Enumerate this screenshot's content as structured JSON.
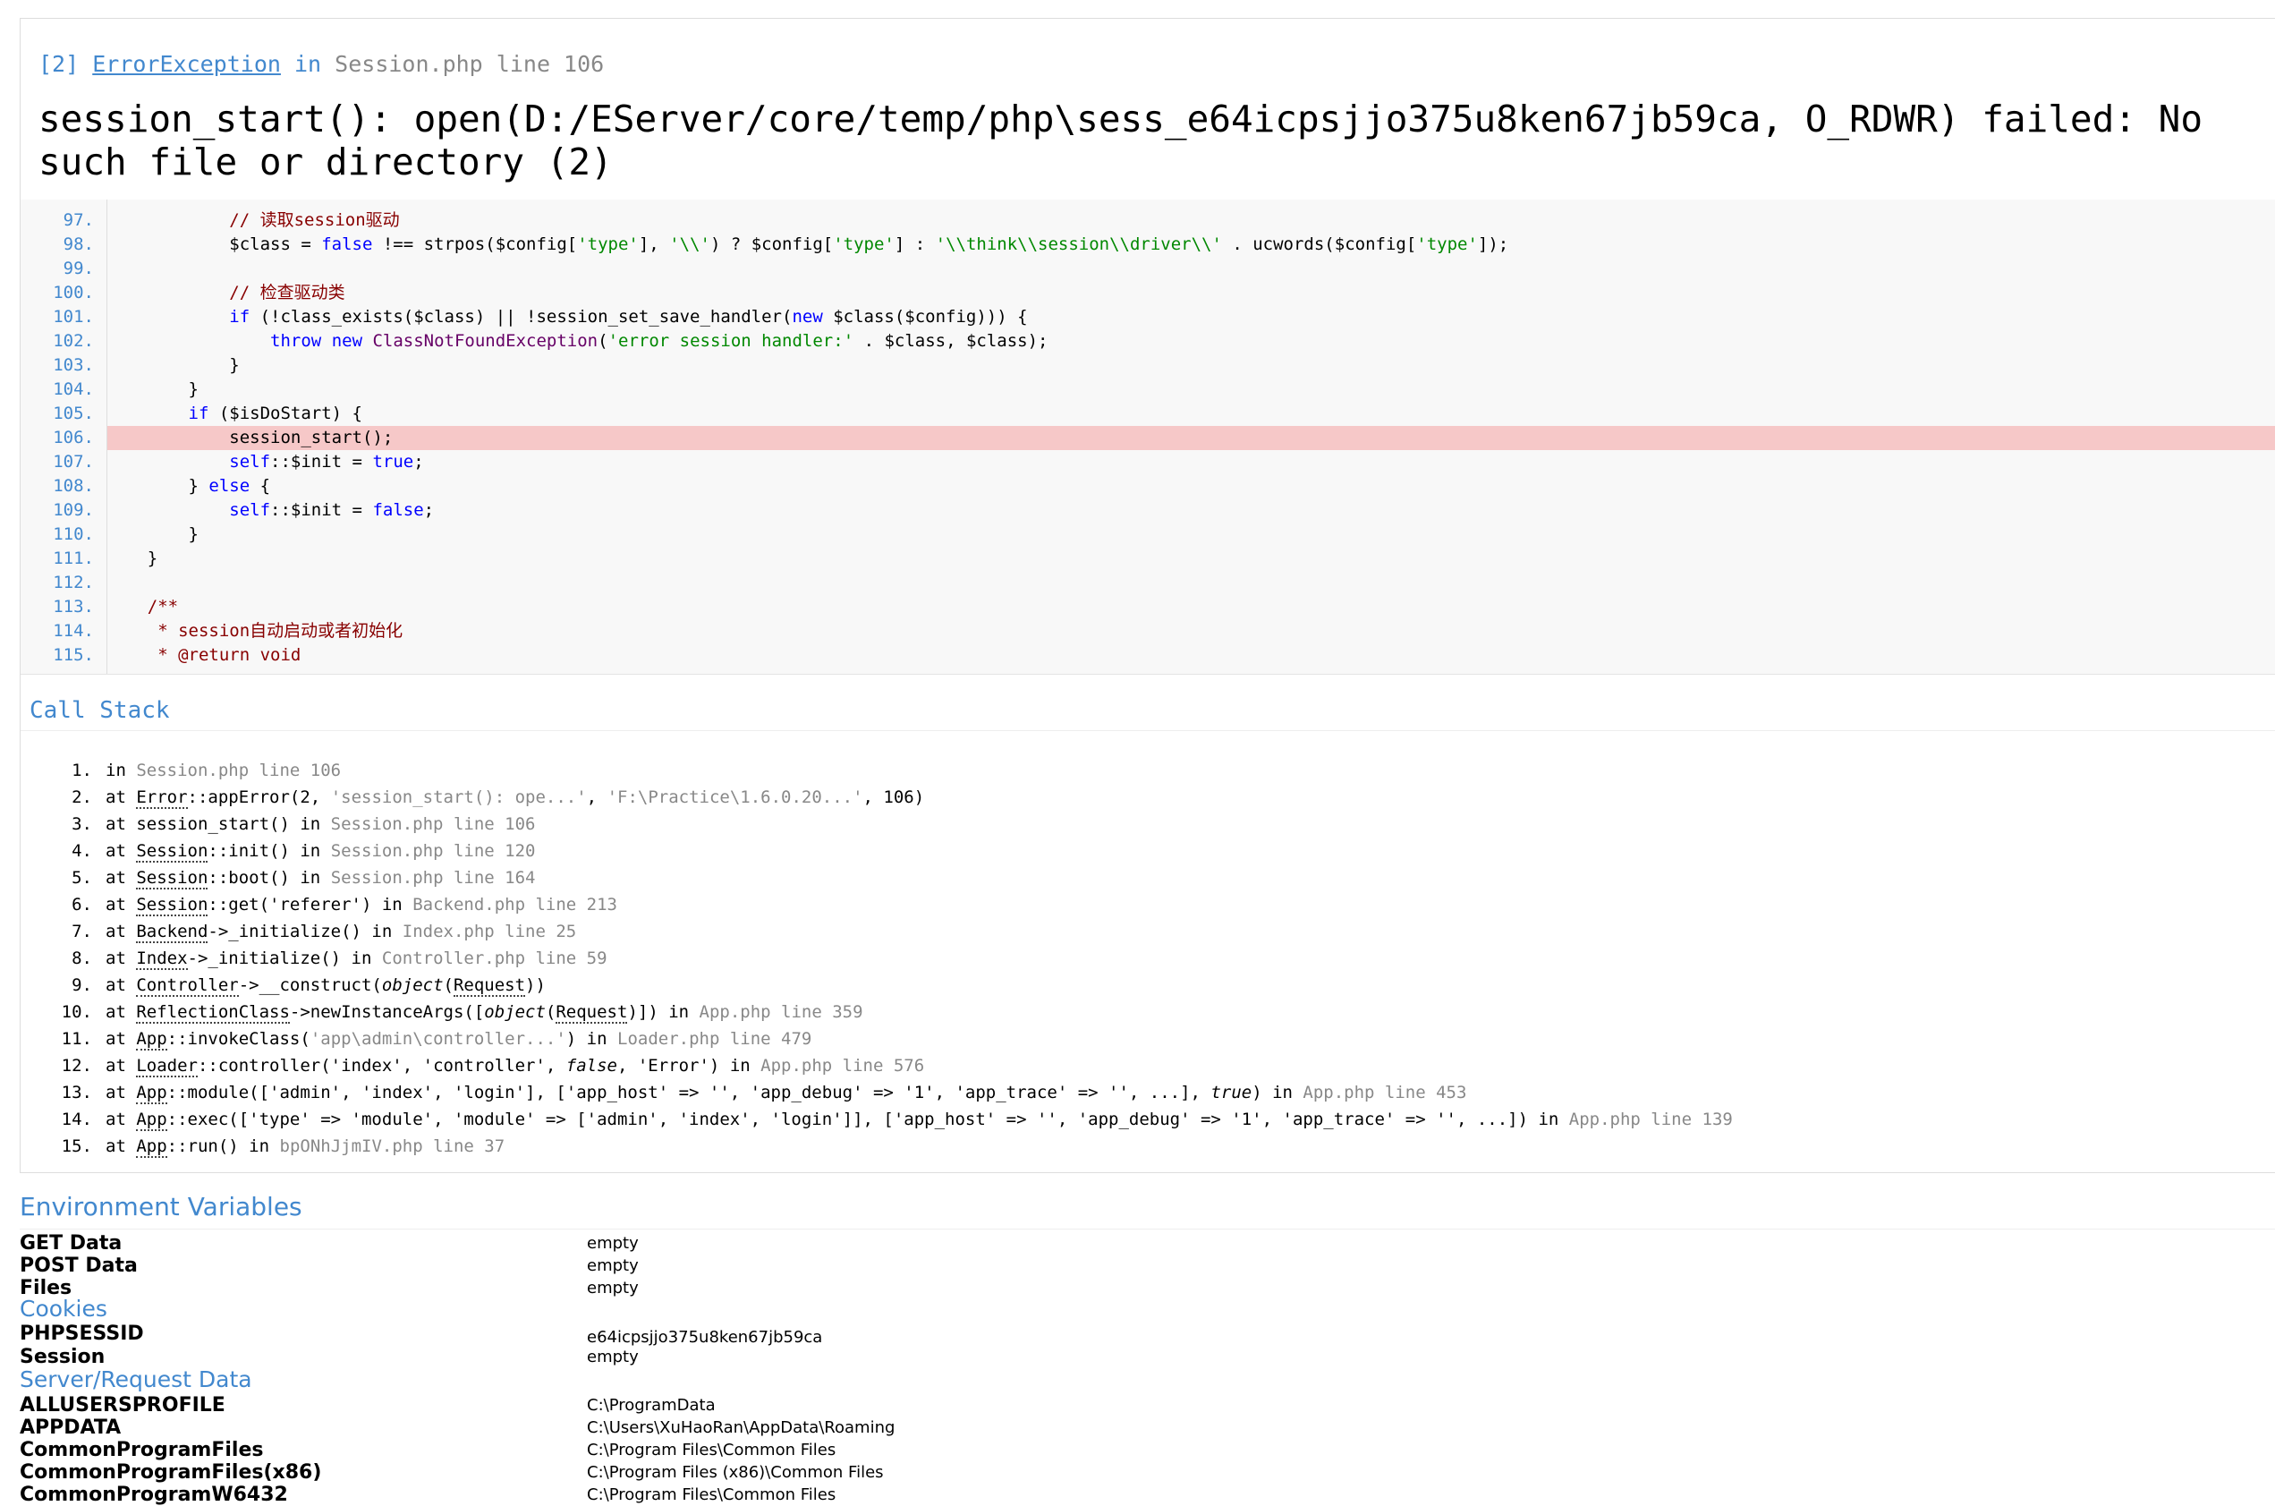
{
  "exception": {
    "code": "[2]",
    "class": "ErrorException",
    "in": "in",
    "file": "Session.php line 106",
    "message": "session_start(): open(D:/EServer/core/temp/php\\sess_e64icpsjjo375u8ken67jb59ca, O_RDWR) failed: No such file or directory (2)"
  },
  "source": {
    "highlight_line": "106.",
    "lines": [
      {
        "no": "97.",
        "html": "            <span class='cmt'>// 读取session驱动</span>"
      },
      {
        "no": "98.",
        "html": "            $class = <span class='kw'>false</span> !== strpos($config[<span class='str'>'type'</span>], <span class='str'>'\\\\'</span>) ? $config[<span class='str'>'type'</span>] : <span class='str'>'\\\\think\\\\session\\\\driver\\\\'</span> . ucwords($config[<span class='str'>'type'</span>]);"
      },
      {
        "no": "99.",
        "html": ""
      },
      {
        "no": "100.",
        "html": "            <span class='cmt'>// 检查驱动类</span>"
      },
      {
        "no": "101.",
        "html": "            <span class='kw'>if</span> (!class_exists($class) || !session_set_save_handler(<span class='kw'>new</span> $class($config))) {"
      },
      {
        "no": "102.",
        "html": "                <span class='kw'>throw</span> <span class='kw'>new</span> <span class='cname'>ClassNotFoundException</span>(<span class='str'>'error session handler:'</span> . $class, $class);"
      },
      {
        "no": "103.",
        "html": "            }"
      },
      {
        "no": "104.",
        "html": "        }"
      },
      {
        "no": "105.",
        "html": "        <span class='kw'>if</span> ($isDoStart) {"
      },
      {
        "no": "106.",
        "html": "            session_start();"
      },
      {
        "no": "107.",
        "html": "            <span class='kw'>self</span>::$init = <span class='kw'>true</span>;"
      },
      {
        "no": "108.",
        "html": "        } <span class='kw'>else</span> {"
      },
      {
        "no": "109.",
        "html": "            <span class='kw'>self</span>::$init = <span class='kw'>false</span>;"
      },
      {
        "no": "110.",
        "html": "        }"
      },
      {
        "no": "111.",
        "html": "    }"
      },
      {
        "no": "112.",
        "html": ""
      },
      {
        "no": "113.",
        "html": "    <span class='cmt'>/**</span>"
      },
      {
        "no": "114.",
        "html": "<span class='cmt'>     * session自动启动或者初始化</span>"
      },
      {
        "no": "115.",
        "html": "<span class='cmt'>     * @return void</span>"
      }
    ]
  },
  "call_stack": {
    "title": "Call Stack",
    "items": [
      {
        "num": "1.",
        "html": "in <span class='gray'>Session.php line 106</span>"
      },
      {
        "num": "2.",
        "html": "at <span class='abbr'>Error</span>::appError(2, <span class='gray'>'session_start(): ope...'</span>, <span class='gray'>'F:\\Practice\\1.6.0.20...'</span>, 106)"
      },
      {
        "num": "3.",
        "html": "at session_start() in <span class='gray'>Session.php line 106</span>"
      },
      {
        "num": "4.",
        "html": "at <span class='abbr'>Session</span>::init() in <span class='gray'>Session.php line 120</span>"
      },
      {
        "num": "5.",
        "html": "at <span class='abbr'>Session</span>::boot() in <span class='gray'>Session.php line 164</span>"
      },
      {
        "num": "6.",
        "html": "at <span class='abbr'>Session</span>::get('referer') in <span class='gray'>Backend.php line 213</span>"
      },
      {
        "num": "7.",
        "html": "at <span class='abbr'>Backend</span>->_initialize() in <span class='gray'>Index.php line 25</span>"
      },
      {
        "num": "8.",
        "html": "at <span class='abbr'>Index</span>->_initialize() in <span class='gray'>Controller.php line 59</span>"
      },
      {
        "num": "9.",
        "html": "at <span class='abbr'>Controller</span>->__construct(<span class='it'>object</span>(<span class='abbr'>Request</span>))"
      },
      {
        "num": "10.",
        "html": "at <span class='abbr'>ReflectionClass</span>->newInstanceArgs([<span class='it'>object</span>(<span class='abbr'>Request</span>)]) in <span class='gray'>App.php line 359</span>"
      },
      {
        "num": "11.",
        "html": "at <span class='abbr'>App</span>::invokeClass(<span class='gray'>'app\\admin\\controller...'</span>) in <span class='gray'>Loader.php line 479</span>"
      },
      {
        "num": "12.",
        "html": "at <span class='abbr'>Loader</span>::controller('index', 'controller', <span class='it'>false</span>, 'Error') in <span class='gray'>App.php line 576</span>"
      },
      {
        "num": "13.",
        "html": "at <span class='abbr'>App</span>::module(['admin', 'index', 'login'], ['app_host' => '', 'app_debug' => '1', 'app_trace' => '', ...], <span class='it'>true</span>) in <span class='gray'>App.php line 453</span>"
      },
      {
        "num": "14.",
        "html": "at <span class='abbr'>App</span>::exec(['type' => 'module', 'module' => ['admin', 'index', 'login']], ['app_host' => '', 'app_debug' => '1', 'app_trace' => '', ...]) in <span class='gray'>App.php line 139</span>"
      },
      {
        "num": "15.",
        "html": "at <span class='abbr'>App</span>::run() in <span class='gray'>bpONhJjmIV.php line 37</span>"
      }
    ]
  },
  "env": {
    "title": "Environment Variables",
    "get_key": "GET Data",
    "get_val": "empty",
    "post_key": "POST Data",
    "post_val": "empty",
    "files_key": "Files",
    "files_val": "empty",
    "cookies_title": "Cookies",
    "phpsessid_key": "PHPSESSID",
    "phpsessid_val": "e64icpsjjo375u8ken67jb59ca",
    "session_key": "Session",
    "session_val": "empty",
    "server_title": "Server/Request Data",
    "allusers_key": "ALLUSERSPROFILE",
    "allusers_val": "C:\\ProgramData",
    "appdata_key": "APPDATA",
    "appdata_val": "C:\\Users\\XuHaoRan\\AppData\\Roaming",
    "cpf_key": "CommonProgramFiles",
    "cpf_val": "C:\\Program Files\\Common Files",
    "cpf86_key": "CommonProgramFiles(x86)",
    "cpf86_val": "C:\\Program Files (x86)\\Common Files",
    "cpw_key": "CommonProgramW6432",
    "cpw_val": "C:\\Program Files\\Common Files"
  }
}
